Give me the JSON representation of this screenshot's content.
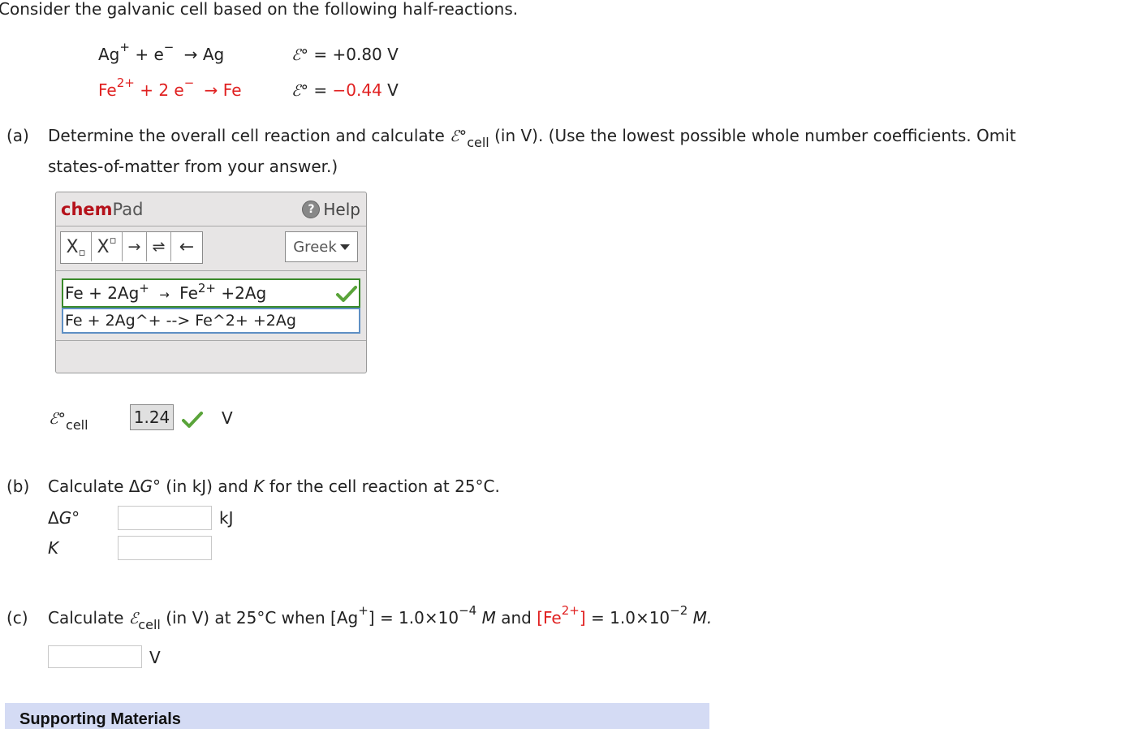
{
  "intro": "Consider the galvanic cell based on the following half-reactions.",
  "half_reactions": [
    {
      "species1": "Ag",
      "charge1": "+",
      "electrons": "+ e",
      "arrow": "→",
      "product": "Ag",
      "e_symbol": "ℰ°",
      "potential": "= +0.80 V"
    },
    {
      "species1": "Fe",
      "charge1": "2+",
      "electrons": "+ 2 e",
      "arrow": "→",
      "product": "Fe",
      "e_symbol": "ℰ°",
      "potential": "= −0.44 V"
    }
  ],
  "electron_superscript": "−",
  "part_a": {
    "label": "(a)",
    "text1": "Determine the overall cell reaction and calculate",
    "symbol": "ℰ°",
    "sub": "cell",
    "text2": "(in V). (Use the lowest possible whole number coefficients. Omit",
    "text3": "states-of-matter from your answer.)",
    "chempad": {
      "title_chem": "chem",
      "title_pad": "Pad",
      "help_label": "Help",
      "toolbar": [
        "Xₒ",
        "Xᵒ",
        "→",
        "⇌",
        "←"
      ],
      "greek_label": "Greek",
      "rendered_answer": {
        "left": "Fe + 2Ag",
        "sup1": "+",
        "arrow": "→",
        "right": "Fe",
        "sup2": "2+",
        "tail": "+2Ag"
      },
      "text_answer": "Fe + 2Ag^+ --> Fe^2+ +2Ag"
    },
    "ecell_label_symbol": "ℰ°",
    "ecell_label_sub": "cell",
    "ecell_value": "1.24",
    "ecell_unit": "V"
  },
  "part_b": {
    "label": "(b)",
    "text": {
      "t1": "Calculate Δ",
      "g": "G",
      "t2": "° (in kJ) and",
      "k": "K",
      "t3": "for the cell reaction at 25°C."
    },
    "dg_label_delta": "Δ",
    "dg_label_g": "G°",
    "dg_unit": "kJ",
    "k_label": "K",
    "dg_value": "",
    "k_value": ""
  },
  "part_c": {
    "label": "(c)",
    "t1": "Calculate",
    "symbol": "ℰ",
    "sub": "cell",
    "t2": "(in V) at 25°C when [Ag",
    "sup_ag": "+",
    "t3": "] = 1.0×10",
    "exp1": "−4",
    "m1": "M",
    "t4": "and",
    "fe_bracket": "[Fe",
    "sup_fe": "2+",
    "fe_close": "]",
    "t5": "= 1.0×10",
    "exp2": "−2",
    "m2": "M.",
    "value": "",
    "unit": "V"
  },
  "supporting": "Supporting Materials",
  "colors": {
    "accent_red": "#e02020",
    "chem_red": "#b5121b",
    "correct_green": "#5aa43a",
    "support_bg": "#d4dbf4"
  }
}
